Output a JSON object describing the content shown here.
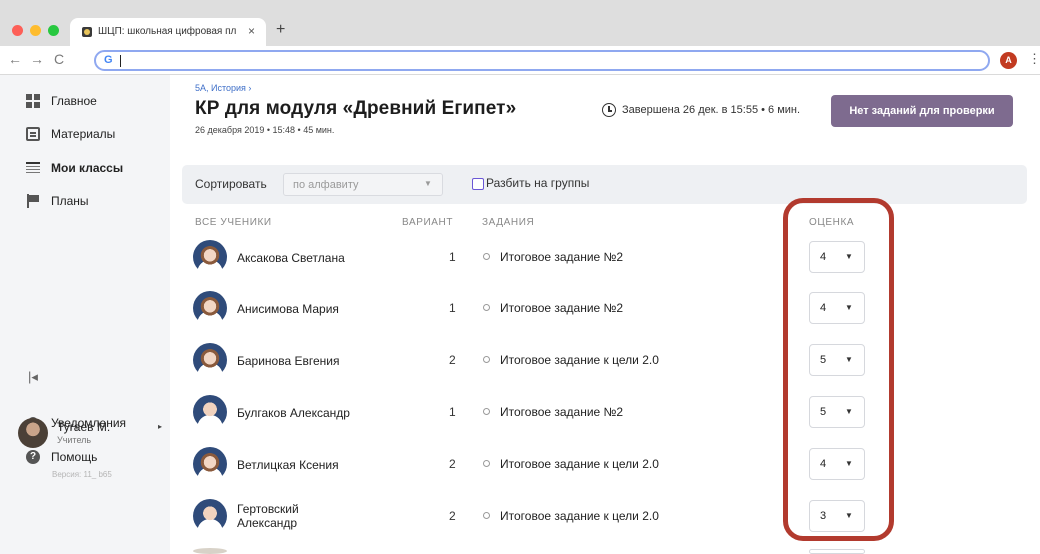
{
  "browser": {
    "tab_title": "ШЦП: школьная цифровая пл",
    "tab_close": "×",
    "new_tab": "+",
    "back": "←",
    "forward": "→",
    "reload": "C",
    "omnibox_badge": "G",
    "omnibox_value": "",
    "profile_initial": "A",
    "menu": "⋮"
  },
  "sidebar": {
    "items": [
      {
        "label": "Главное",
        "icon": "dashboard-icon"
      },
      {
        "label": "Материалы",
        "icon": "clipboard-icon"
      },
      {
        "label": "Мои классы",
        "icon": "table-icon"
      },
      {
        "label": "Планы",
        "icon": "flag-icon"
      }
    ],
    "collapse": "|◂",
    "notifications": "Уведомления",
    "help": "Помощь",
    "help_glyph": "?",
    "user": {
      "name": "Тугаев М.",
      "role": "Учитель",
      "caret": "▸"
    },
    "version": "Версия: 11_ b65"
  },
  "header": {
    "breadcrumb": "5А, История ›",
    "title": "КР для модуля «Древний Египет»",
    "subtitle": "26 декабря 2019 • 15:48 • 45 мин.",
    "status": "Завершена 26 дек. в 15:55 • 6 мин.",
    "review_button": "Нет заданий для проверки"
  },
  "filters": {
    "sort_label": "Сортировать",
    "sort_value": "по алфавиту",
    "group_label": "Разбить на группы",
    "group_checked": false
  },
  "table": {
    "headers": {
      "students": "ВСЕ УЧЕНИКИ",
      "variant": "ВАРИАНТ",
      "tasks": "ЗАДАНИЯ",
      "grade": "ОЦЕНКА"
    },
    "rows": [
      {
        "name": "Аксакова Светлана",
        "variant": "1",
        "task": "Итоговое задание №2",
        "grade": "4"
      },
      {
        "name": "Анисимова Мария",
        "variant": "1",
        "task": "Итоговое задание №2",
        "grade": "4"
      },
      {
        "name": "Баринова Евгения",
        "variant": "2",
        "task": "Итоговое задание к цели 2.0",
        "grade": "5"
      },
      {
        "name": "Булгаков Александр",
        "variant": "1",
        "task": "Итоговое задание №2",
        "grade": "5"
      },
      {
        "name": "Ветлицкая Ксения",
        "variant": "2",
        "task": "Итоговое задание к цели 2.0",
        "grade": "4"
      },
      {
        "name_line1": "Гертовский",
        "name_line2": "Александр",
        "variant": "2",
        "task": "Итоговое задание к цели 2.0",
        "grade": "3"
      }
    ]
  },
  "colors": {
    "accent_button": "#7e6b8f",
    "highlight": "#b23a2e",
    "link": "#3f6fc8",
    "sidebar_bg": "#f4f5f7"
  }
}
